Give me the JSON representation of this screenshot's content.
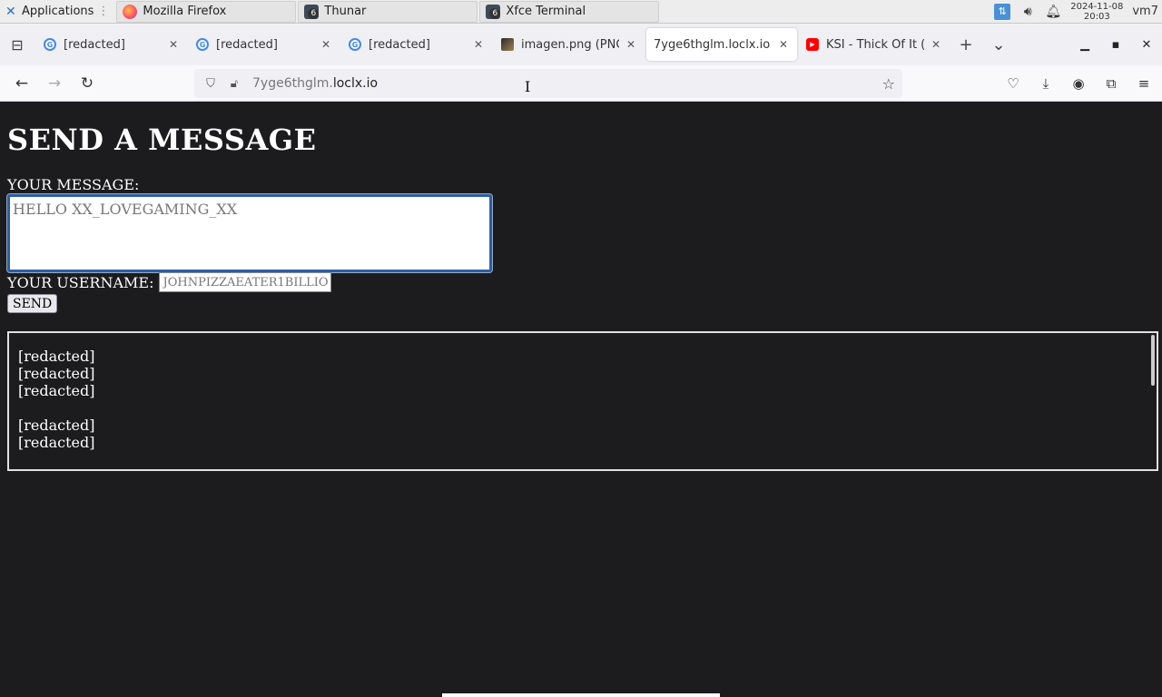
{
  "note": "Chat-log text and several browser tab titles in the source screenshot contained slurs and sexually violent content; they are redacted here.",
  "taskbar": {
    "apps_label": "Applications",
    "windows": [
      {
        "label": "Mozilla Firefox",
        "icon": "firefox-icon"
      },
      {
        "label": "Thunar",
        "icon": "window-group-icon",
        "count": "6"
      },
      {
        "label": "Xfce Terminal",
        "icon": "window-group-icon",
        "count": "6"
      }
    ],
    "clock_date": "2024-11-08",
    "clock_time": "20:03",
    "host": "vm7"
  },
  "tabs": [
    {
      "label": "[redacted]",
      "icon": "google-icon"
    },
    {
      "label": "[redacted]",
      "icon": "google-icon"
    },
    {
      "label": "[redacted]",
      "icon": "google-icon"
    },
    {
      "label": "imagen.png (PNG",
      "icon": "image-icon"
    },
    {
      "label": "7yge6thglm.loclx.io",
      "icon": "none",
      "active": true
    },
    {
      "label": "KSI - Thick Of It (",
      "icon": "youtube-icon"
    }
  ],
  "urlbar": {
    "subdomain": "7yge6thglm.",
    "domain": "loclx.io"
  },
  "page": {
    "title": "SEND A MESSAGE",
    "message_label": "YOUR MESSAGE:",
    "message_placeholder": "HELLO XX_LOVEGAMING_XX",
    "username_label": "YOUR USERNAME:",
    "username_placeholder": "JOHNPIZZAEATER1BILLIO",
    "send_label": "SEND",
    "chat_lines": [
      "[redacted]",
      "[redacted]",
      "[redacted]",
      "",
      "[redacted]",
      "[redacted]"
    ]
  },
  "colors": {
    "page_bg": "#1c1b1d",
    "focus_ring": "#2a5ea8"
  }
}
